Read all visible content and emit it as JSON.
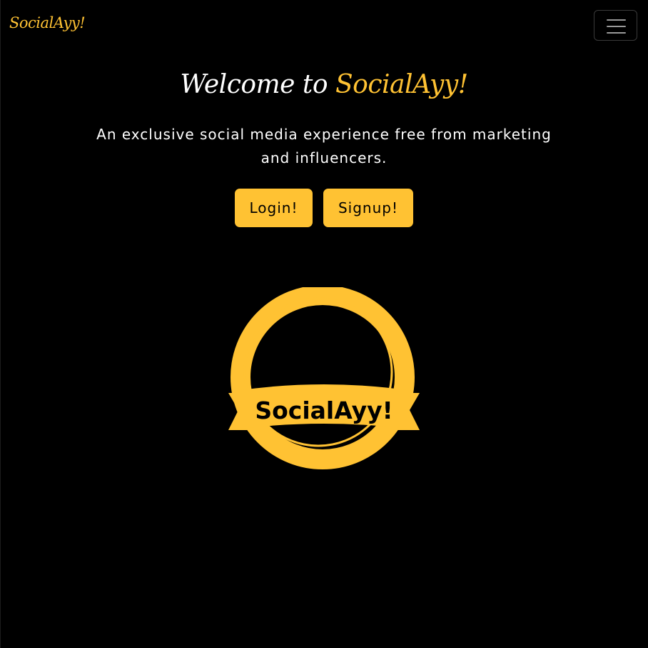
{
  "navbar": {
    "brand": "SocialAyy!",
    "toggler_icon": "hamburger-menu-icon"
  },
  "hero": {
    "title_prefix": "Welcome to ",
    "title_brand": "SocialAyy!",
    "lead": "An exclusive social media experience free from marketing and influencers.",
    "login_label": "Login!",
    "signup_label": "Signup!"
  },
  "logo": {
    "text": "SocialAyy!",
    "icon": "socialayy-badge-logo"
  },
  "colors": {
    "background": "#000000",
    "accent": "#ffc233",
    "text": "#ffffff"
  }
}
